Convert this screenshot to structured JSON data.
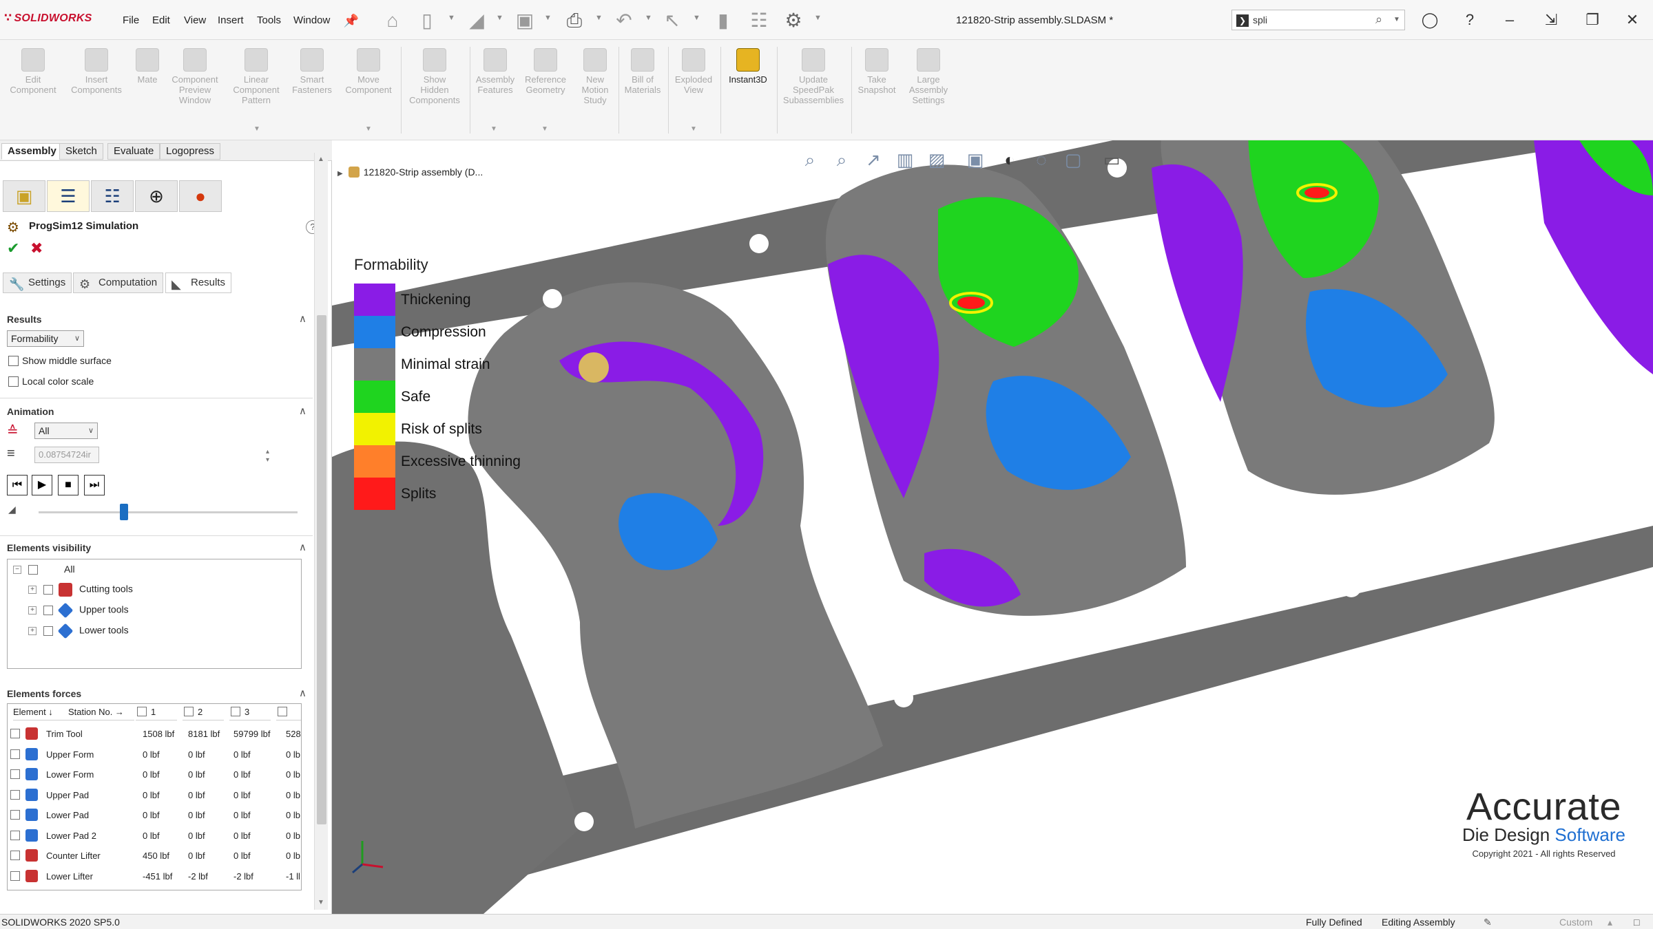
{
  "app": {
    "brand": "SOLIDWORKS",
    "document_title": "121820-Strip assembly.SLDASM *"
  },
  "menu": [
    "File",
    "Edit",
    "View",
    "Insert",
    "Tools",
    "Window"
  ],
  "search": {
    "value": "spli"
  },
  "command_manager": {
    "items": [
      {
        "label": "Edit\nComponent"
      },
      {
        "label": "Insert\nComponents"
      },
      {
        "label": "Mate"
      },
      {
        "label": "Component\nPreview\nWindow"
      },
      {
        "label": "Linear\nComponent\nPattern"
      },
      {
        "label": "Smart\nFasteners"
      },
      {
        "label": "Move\nComponent"
      },
      {
        "label": "Show\nHidden\nComponents"
      },
      {
        "label": "Assembly\nFeatures"
      },
      {
        "label": "Reference\nGeometry"
      },
      {
        "label": "New\nMotion\nStudy"
      },
      {
        "label": "Bill of\nMaterials"
      },
      {
        "label": "Exploded\nView"
      },
      {
        "label": "Instant3D"
      },
      {
        "label": "Update\nSpeedPak\nSubassemblies"
      },
      {
        "label": "Take\nSnapshot"
      },
      {
        "label": "Large\nAssembly\nSettings"
      }
    ]
  },
  "tabs": [
    "Assembly",
    "Sketch",
    "Evaluate",
    "Logopress"
  ],
  "property_manager": {
    "title": "ProgSim12 Simulation",
    "tabs": [
      "Settings",
      "Computation",
      "Results"
    ],
    "results": {
      "header": "Results",
      "dropdown_value": "Formability",
      "show_middle_surface": "Show middle surface",
      "local_color_scale": "Local color scale"
    },
    "animation": {
      "header": "Animation",
      "dropdown_value": "All",
      "field_value": "0.08754724ir"
    },
    "elements_visibility": {
      "header": "Elements visibility",
      "tree": [
        "All",
        "Cutting tools",
        "Upper tools",
        "Lower tools"
      ]
    },
    "elements_forces": {
      "header": "Elements forces",
      "columns": [
        "Element ↓",
        "Station No. →",
        "1",
        "2",
        "3"
      ],
      "rows": [
        {
          "name": "Trim Tool",
          "v1": "1508 lbf",
          "v2": "8181 lbf",
          "v3": "59799 lbf",
          "v4": "528"
        },
        {
          "name": "Upper Form",
          "v1": "0 lbf",
          "v2": "0 lbf",
          "v3": "0 lbf",
          "v4": "0 lb"
        },
        {
          "name": "Lower Form",
          "v1": "0 lbf",
          "v2": "0 lbf",
          "v3": "0 lbf",
          "v4": "0 lb"
        },
        {
          "name": "Upper Pad",
          "v1": "0 lbf",
          "v2": "0 lbf",
          "v3": "0 lbf",
          "v4": "0 lb"
        },
        {
          "name": "Lower Pad",
          "v1": "0 lbf",
          "v2": "0 lbf",
          "v3": "0 lbf",
          "v4": "0 lb"
        },
        {
          "name": "Lower Pad 2",
          "v1": "0 lbf",
          "v2": "0 lbf",
          "v3": "0 lbf",
          "v4": "0 lb"
        },
        {
          "name": "Counter Lifter",
          "v1": "450 lbf",
          "v2": "0 lbf",
          "v3": "0 lbf",
          "v4": "0 lb"
        },
        {
          "name": "Lower Lifter",
          "v1": "-451 lbf",
          "v2": "-2 lbf",
          "v3": "-2 lbf",
          "v4": "-1 ll"
        }
      ]
    }
  },
  "viewport": {
    "breadcrumb": "121820-Strip assembly  (D...",
    "legend": {
      "title": "Formability",
      "items": [
        {
          "label": "Thickening",
          "color": "#8a1ce6"
        },
        {
          "label": "Compression",
          "color": "#1f7fe6"
        },
        {
          "label": "Minimal strain",
          "color": "#7a7a7a"
        },
        {
          "label": "Safe",
          "color": "#1fd41f"
        },
        {
          "label": "Risk of splits",
          "color": "#f2f200"
        },
        {
          "label": "Excessive thinning",
          "color": "#ff7f2a"
        },
        {
          "label": "Splits",
          "color": "#ff1a1a"
        }
      ]
    },
    "watermark": {
      "line1": "Accurate",
      "line2a": "Die Design ",
      "line2b": "Software",
      "line3": "Copyright 2021 - All rights Reserved"
    }
  },
  "status_bar": {
    "version": "SOLIDWORKS 2020 SP5.0",
    "state": "Fully Defined",
    "mode": "Editing Assembly",
    "units": "Custom"
  }
}
